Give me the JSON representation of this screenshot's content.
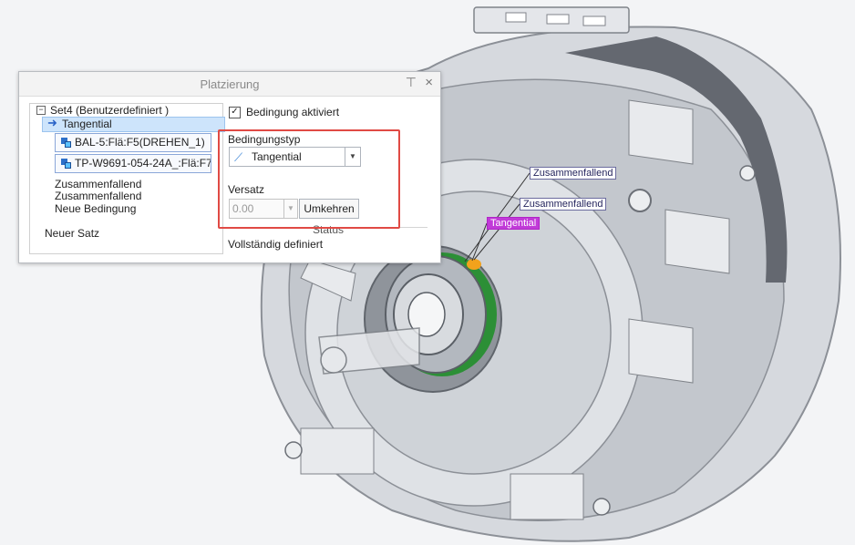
{
  "dialog": {
    "title": "Platzierung",
    "pin_icon": "pin-icon",
    "close_icon": "close-icon",
    "close_glyph": "×",
    "tree": {
      "expander_glyph": "−",
      "set_label": "Set4 (Benutzerdefiniert )",
      "selected_constraint": "Tangential",
      "refs": [
        "BAL-5:Flä:F5(DREHEN_1)",
        "TP-W9691-054-24A_:Flä:F7("
      ],
      "constraints": [
        "Zusammenfallend",
        "Zusammenfallend",
        "Neue Bedingung"
      ],
      "new_set": "Neuer Satz"
    },
    "properties": {
      "checkbox_glyph": "✓",
      "constraint_enabled_label": "Bedingung aktiviert",
      "constraint_type_label": "Bedingungstyp",
      "constraint_type_value": "Tangential",
      "constraint_type_icon": "tangent-icon",
      "offset_label": "Versatz",
      "offset_value": "0.00",
      "flip_button": "Umkehren",
      "status_label": "Status",
      "status_value": "Vollständig definiert"
    }
  },
  "callouts": [
    {
      "text": "Zusammenfallend",
      "color": "#ffffff",
      "border": "#6b6b9e",
      "text_color": "#26265e"
    },
    {
      "text": "Zusammenfallend",
      "color": "#ffffff",
      "border": "#6b6b9e",
      "text_color": "#26265e"
    },
    {
      "text": "Tangential",
      "color": "#c13ad8",
      "border": "#b026c7",
      "text_color": "#ffffff"
    }
  ],
  "colors": {
    "highlight_red": "#e04a44",
    "selection": "#cde4fb"
  }
}
